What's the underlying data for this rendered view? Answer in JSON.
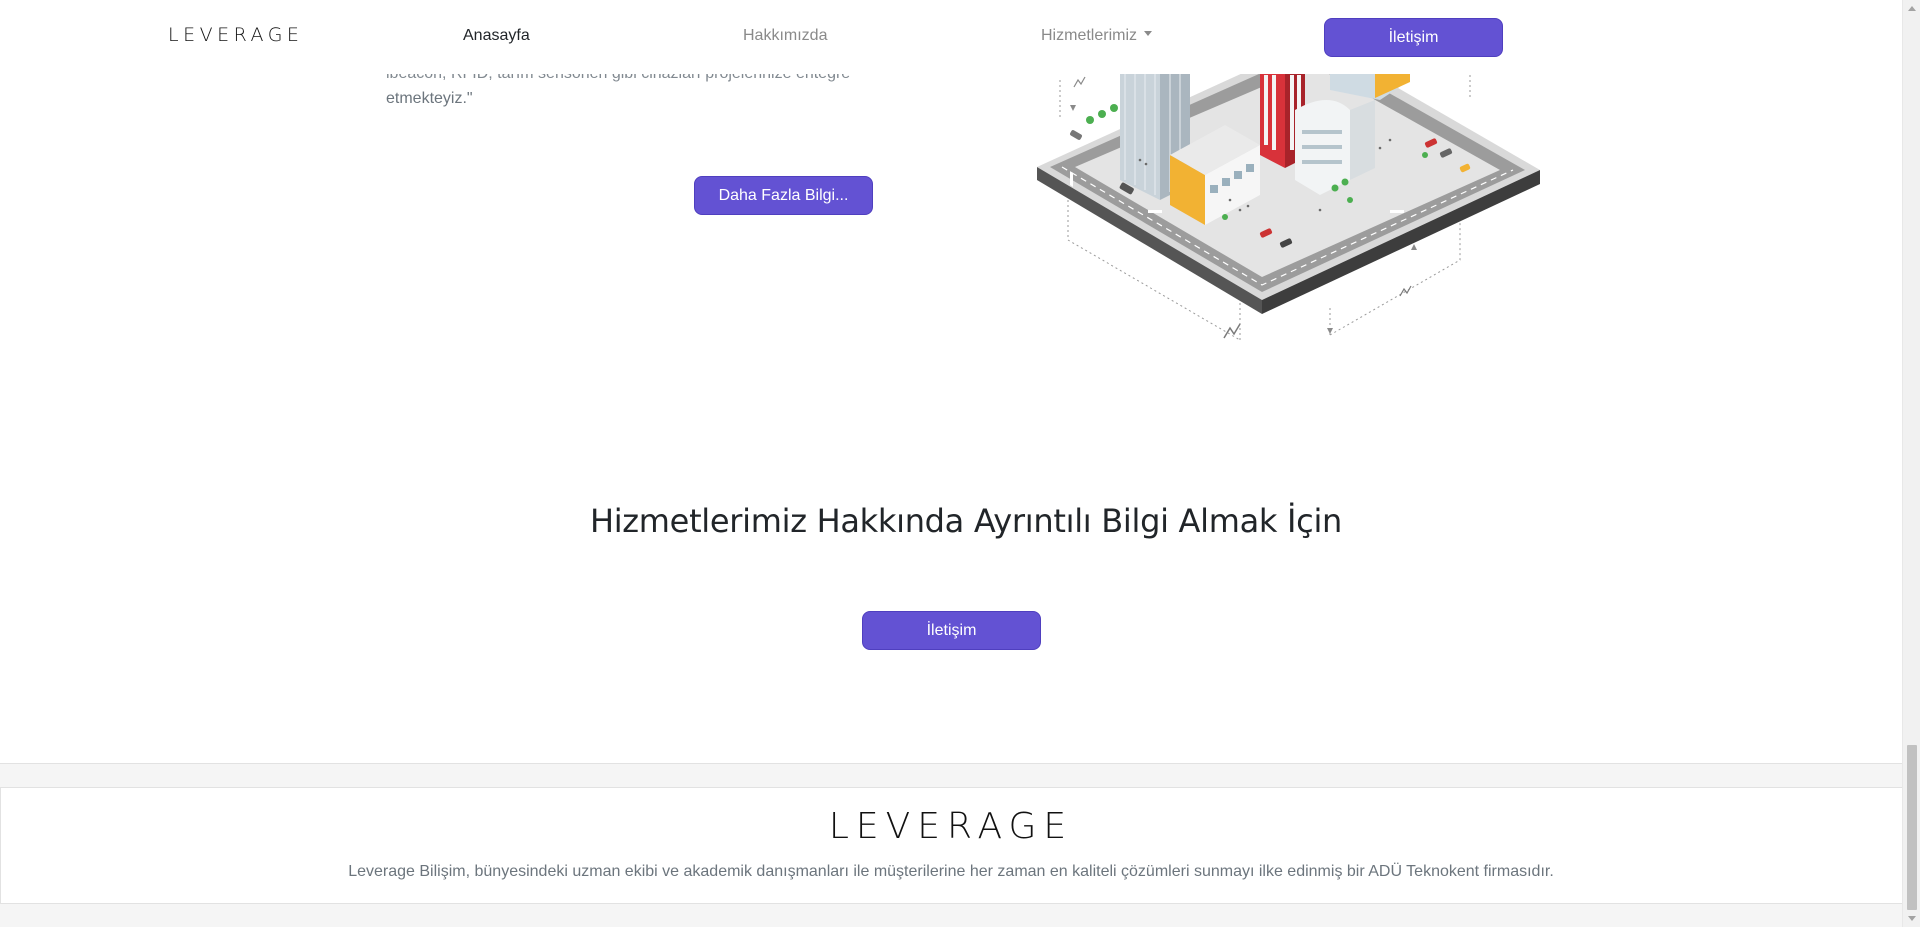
{
  "navbar": {
    "logo": "LEVERAGE",
    "links": {
      "home": "Anasayfa",
      "about": "Hakkımızda",
      "services": "Hizmetlerimiz"
    },
    "contact_button": "İletişim"
  },
  "intro": {
    "text_line1_partial": "lbeacon, RFID, tarım sensörleri gibi cihazları projelerinize entegre",
    "text_line2": "etmekteyiz.\"",
    "more_button": "Daha Fazla Bilgi..."
  },
  "cta": {
    "title": "Hizmetlerimiz Hakkında Ayrıntılı Bilgi Almak İçin",
    "button": "İletişim"
  },
  "footer": {
    "logo": "LEVERAGE",
    "description": "Leverage Bilişim, bünyesindeki uzman ekibi ve akademik danışmanları ile müşterilerine her zaman en kaliteli çözümleri sunmayı ilke edinmiş bir ADÜ Teknokent firmasıdır."
  },
  "colors": {
    "accent": "#6352d3",
    "muted_text": "#6c757d",
    "footer_band": "#f5f5f5"
  }
}
